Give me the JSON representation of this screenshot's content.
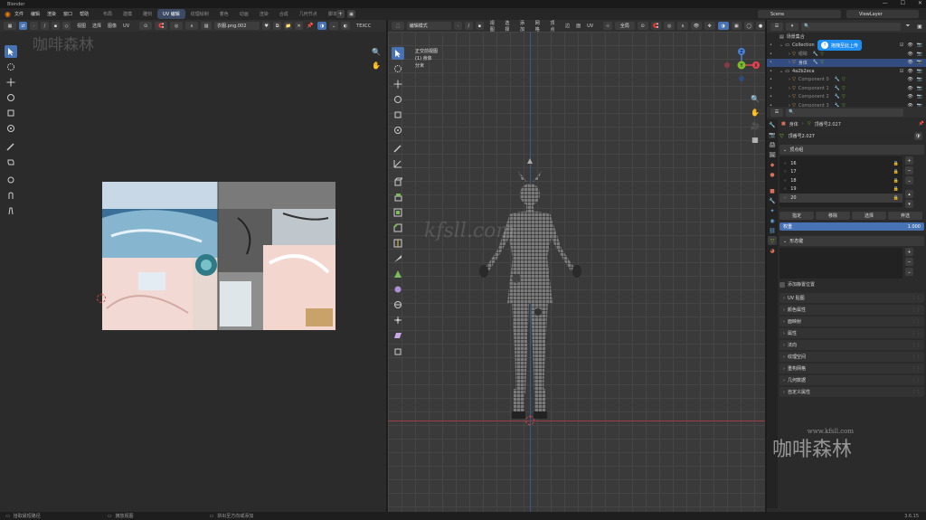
{
  "window": {
    "title": "Blender",
    "min_icon": "minimize-icon",
    "max_icon": "maximize-icon",
    "close_icon": "close-icon"
  },
  "menu": [
    "文件",
    "编辑",
    "渲染",
    "窗口",
    "帮助"
  ],
  "workspaces": [
    "布局",
    "建模",
    "雕刻",
    "UV 编辑",
    "纹理绘制",
    "着色",
    "动画",
    "渲染",
    "合成",
    "几何节点",
    "脚本"
  ],
  "active_workspace": "UV 编辑",
  "scene": {
    "label": "Scene",
    "view_layer": "ViewLayer"
  },
  "uv_header": {
    "menus": [
      "视图",
      "选择",
      "图像",
      "UV"
    ],
    "image_name": "衣服.png.002",
    "texcoord": "TEXCC"
  },
  "viewport_header": {
    "mode": "编辑模式",
    "menus": [
      "视图",
      "选择",
      "添加",
      "网格",
      "顶点",
      "边",
      "面",
      "UV"
    ],
    "transform": "全局",
    "options": "选项",
    "axes": [
      "X",
      "Y",
      "Z"
    ]
  },
  "viewport_info": {
    "line1": "正交前视图",
    "line2": "(1) 身体",
    "line3": "分米"
  },
  "gizmo": {
    "x": "X",
    "y": "Y",
    "z": "Z"
  },
  "outliner": {
    "root": "场景集合",
    "items": [
      {
        "name": "Collection",
        "level": 1,
        "dim": false
      },
      {
        "name": "眼睛",
        "level": 2,
        "dim": true
      },
      {
        "name": "身体",
        "level": 2,
        "dim": false,
        "selected": true
      },
      {
        "name": "4a2b2eca",
        "level": 1,
        "dim": false
      },
      {
        "name": "Component 0",
        "level": 2,
        "dim": true
      },
      {
        "name": "Component 1",
        "level": 2,
        "dim": true
      },
      {
        "name": "Component 2",
        "level": 2,
        "dim": true
      },
      {
        "name": "Component 3",
        "level": 2,
        "dim": true
      }
    ],
    "upload_badge": "拖拽至此上传"
  },
  "properties": {
    "breadcrumb_object": "身体",
    "breadcrumb_mesh": "顶番号2.027",
    "mesh_name": "顶番号2.027",
    "vertex_groups_title": "顶点组",
    "vertex_groups": [
      "16",
      "17",
      "18",
      "19",
      "20"
    ],
    "vg_buttons": [
      "指定",
      "移除",
      "选择",
      "弃选"
    ],
    "weight_label": "权重",
    "weight_value": "1.000",
    "shape_keys_title": "形态键",
    "relative_label": "添加静置位置",
    "collapsed_panels": [
      "UV 贴图",
      "颜色属性",
      "面映射",
      "属性",
      "法向",
      "纹理空间",
      "重构网格",
      "几何数据",
      "自定义属性"
    ]
  },
  "statusbar": {
    "left": "拾取最短路径",
    "mid": "摘放视图",
    "mid2": "拼出至方向或添加",
    "version": "3.6.15"
  },
  "watermarks": {
    "top_left": "咖啡森林",
    "center": "kfsll.com",
    "bottom_right_url": "www.kfsll.com",
    "bottom_right_name": "咖啡森林"
  },
  "colors": {
    "accent": "#4772b3",
    "selection": "#334d80",
    "x_axis": "#e04454",
    "y_axis": "#7dbb2c",
    "z_axis": "#4a7fd4"
  }
}
